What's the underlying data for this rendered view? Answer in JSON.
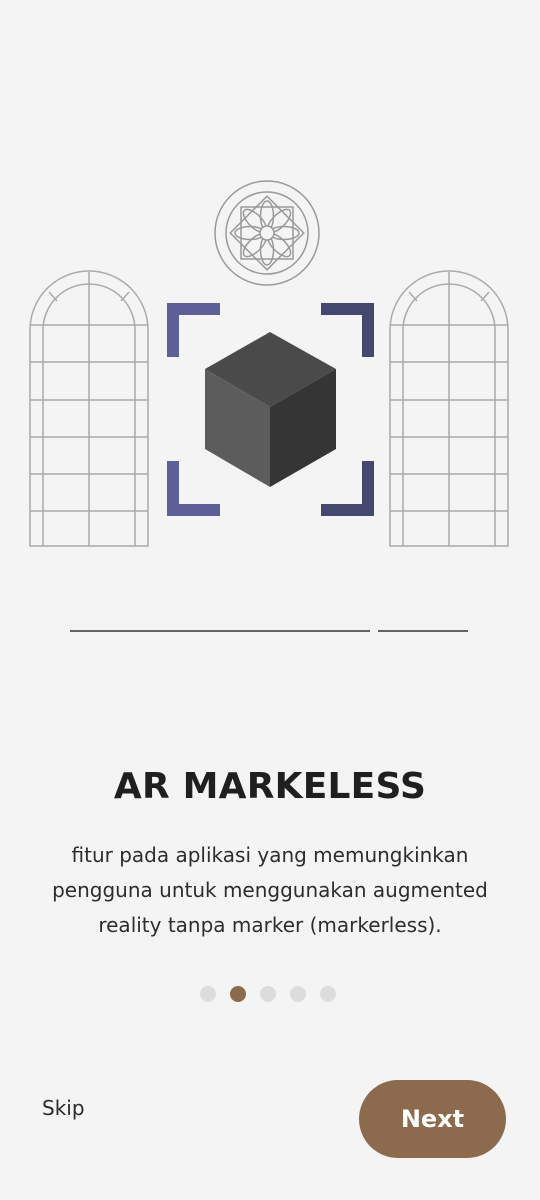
{
  "onboarding": {
    "title": "AR MARKELESS",
    "description": "fitur pada aplikasi yang memungkinkan pengguna untuk menggunakan augmented reality tanpa marker (markerless).",
    "pagination": {
      "total": 5,
      "active_index": 1
    },
    "skip_label": "Skip",
    "next_label": "Next"
  },
  "colors": {
    "background": "#f4f4f4",
    "accent": "#8b6a4e",
    "dot_inactive": "#dcdcdc",
    "frame_bracket": "#585a8f",
    "cube_top": "#4a4a4a",
    "cube_left": "#5c5c5c",
    "cube_right": "#353535",
    "line_art": "#aaaaaa"
  },
  "icons": {
    "ar_cube": "ar-cube-icon",
    "window": "arched-window-icon",
    "rosette": "rosette-window-icon"
  }
}
